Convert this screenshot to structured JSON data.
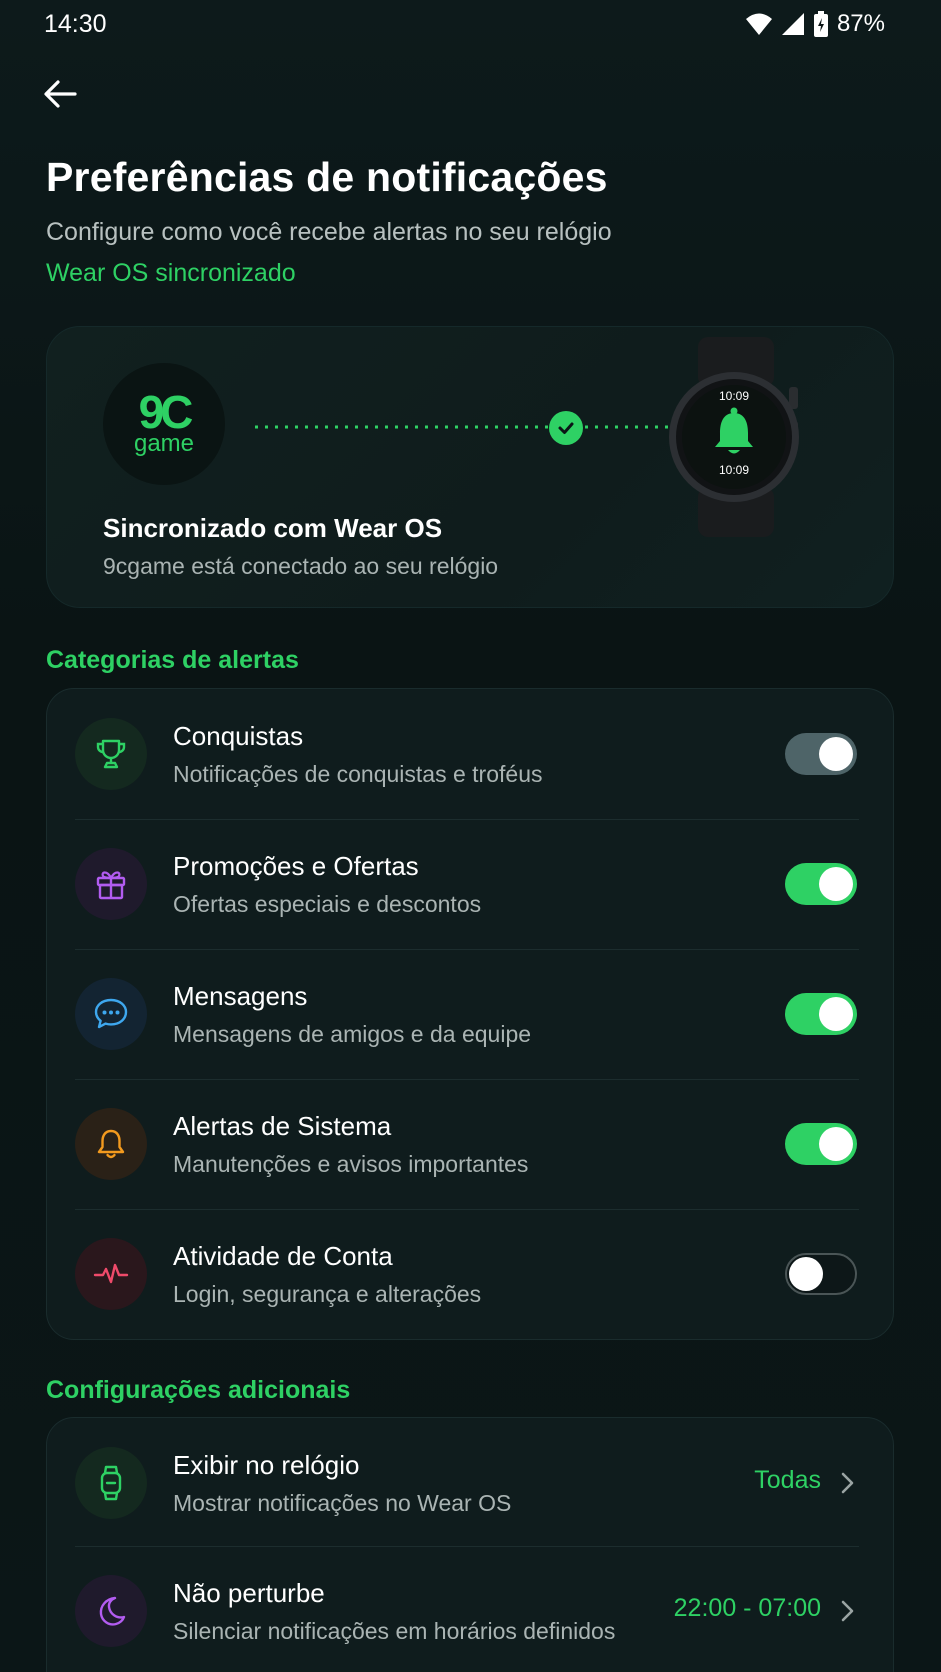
{
  "status_bar": {
    "time": "14:30",
    "battery": "87%",
    "icons": [
      "wifi-icon",
      "signal-icon",
      "battery-icon"
    ]
  },
  "header": {
    "back_icon": "arrow-left-icon",
    "title": "Preferências de notificações",
    "subtitle": "Configure como você recebe alertas no seu relógio",
    "sync_status": "Wear OS sincronizado"
  },
  "sync_card": {
    "logo_main": "9C",
    "logo_sub": "game",
    "watch_time_top": "10:09",
    "watch_time_bottom": "10:09",
    "title": "Sincronizado com Wear OS",
    "description": "9cgame está conectado ao seu relógio"
  },
  "alert_categories": {
    "section_title": "Categorias de alertas",
    "items": [
      {
        "title": "Conquistas",
        "description": "Notificações de conquistas e troféus",
        "icon": "trophy-icon",
        "enabled": true,
        "accent": "#2ed164"
      },
      {
        "title": "Promoções e Ofertas",
        "description": "Ofertas especiais e descontos",
        "icon": "gift-icon",
        "enabled": true,
        "accent": "#b25cf0"
      },
      {
        "title": "Mensagens",
        "description": "Mensagens de amigos e da equipe",
        "icon": "chat-icon",
        "enabled": true,
        "accent": "#3ea7ee"
      },
      {
        "title": "Alertas de Sistema",
        "description": "Manutenções e avisos importantes",
        "icon": "bell-icon",
        "enabled": true,
        "accent": "#f39a1e"
      },
      {
        "title": "Atividade de Conta",
        "description": "Login, segurança e alterações",
        "icon": "activity-icon",
        "enabled": false,
        "accent": "#ef4a6a"
      }
    ]
  },
  "additional_settings": {
    "section_title": "Configurações adicionais",
    "items": [
      {
        "title": "Exibir no relógio",
        "description": "Mostrar notificações no Wear OS",
        "value": "Todas",
        "icon": "watch-icon"
      },
      {
        "title": "Não perturbe",
        "description": "Silenciar notificações em horários definidos",
        "value": "22:00 - 07:00",
        "icon": "moon-icon"
      }
    ]
  },
  "colors": {
    "accent": "#2ed164",
    "background": "#0b1516",
    "card": "#0f1c1d"
  }
}
